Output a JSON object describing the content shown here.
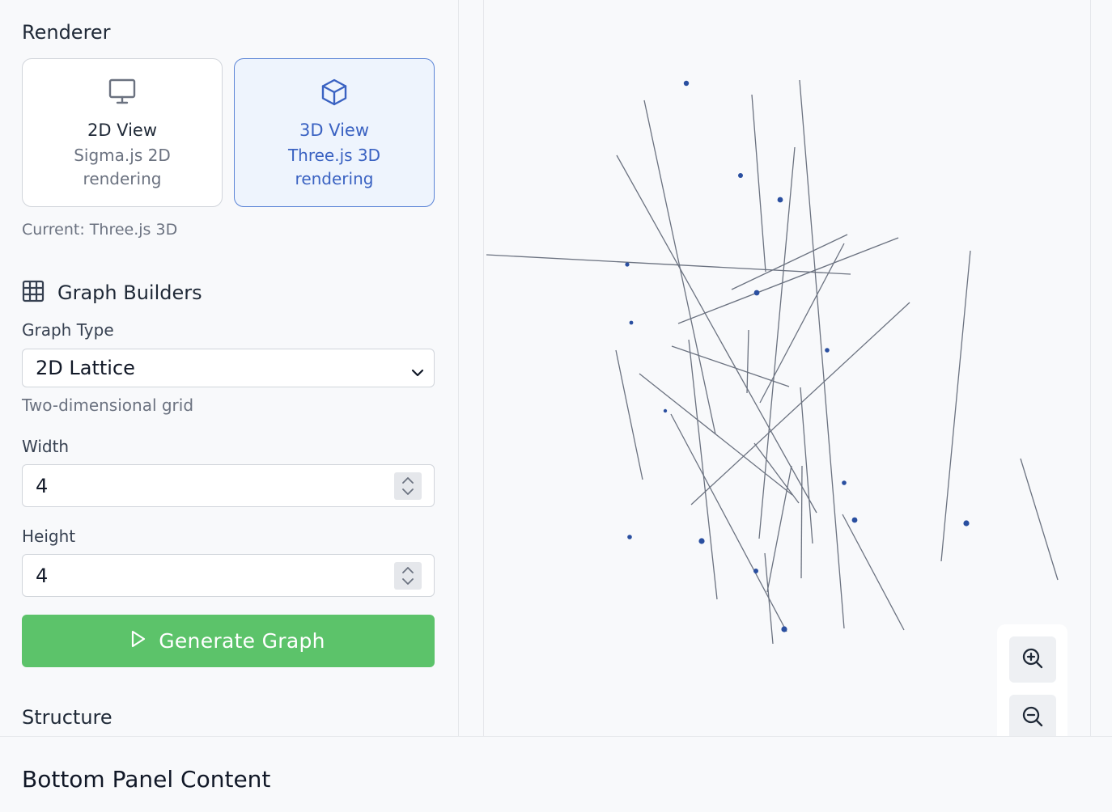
{
  "sidebar": {
    "renderer": {
      "title": "Renderer",
      "options": [
        {
          "title": "2D View",
          "desc": "Sigma.js 2D rendering",
          "icon": "monitor-icon",
          "active": false
        },
        {
          "title": "3D View",
          "desc": "Three.js 3D rendering",
          "icon": "cube-icon",
          "active": true
        }
      ],
      "current": "Current: Three.js 3D"
    },
    "builders": {
      "title": "Graph Builders",
      "icon": "grid-icon",
      "graph_type_label": "Graph Type",
      "graph_type_value": "2D Lattice",
      "graph_type_hint": "Two-dimensional grid",
      "width_label": "Width",
      "width_value": "4",
      "height_label": "Height",
      "height_value": "4",
      "generate_label": "Generate Graph"
    },
    "structure_title": "Structure"
  },
  "canvas": {
    "zoom_in_icon": "zoom-in-icon",
    "zoom_out_icon": "zoom-out-icon"
  },
  "bottom_panel": {
    "title": "Bottom Panel Content"
  },
  "colors": {
    "accent": "#3a62c2",
    "generate": "#5cc36a",
    "node": "#2a4fa0",
    "edge": "#6b7280"
  }
}
